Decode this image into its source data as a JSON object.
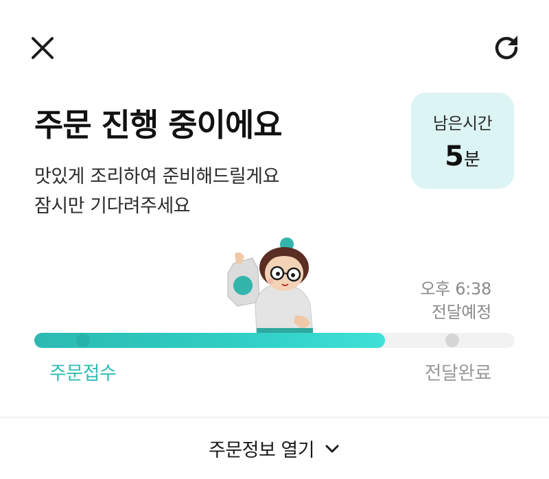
{
  "header": {
    "close_icon": "close-icon",
    "refresh_icon": "refresh-icon"
  },
  "status": {
    "title": "주문 진행 중이에요",
    "message_line1": "맛있게 조리하여 준비해드릴게요",
    "message_line2": "잠시만 기다려주세요"
  },
  "remaining_time": {
    "label": "남은시간",
    "value": "5",
    "unit": "분"
  },
  "eta": {
    "time": "오후 6:38",
    "label": "전달예정"
  },
  "progress": {
    "fraction": 0.73,
    "steps": [
      "주문접수",
      "전달완료"
    ]
  },
  "footer": {
    "toggle_label": "주문정보 열기",
    "toggle_icon": "chevron-down-icon"
  },
  "colors": {
    "accent": "#2fbdb5",
    "card_bg": "#dcf4f3",
    "track": "#f2f2f2"
  }
}
